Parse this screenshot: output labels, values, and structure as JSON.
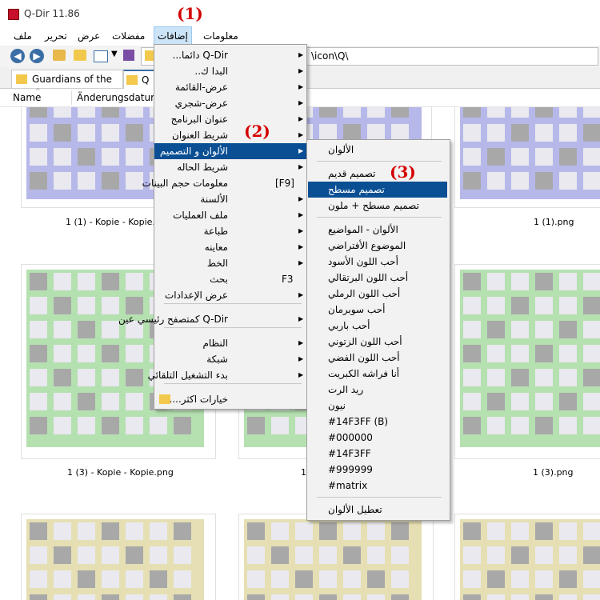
{
  "window": {
    "title": "Q-Dir 11.86"
  },
  "menubar": {
    "items": [
      {
        "label": "معلومات"
      },
      {
        "label": "إضافات"
      },
      {
        "label": "مفضلات"
      },
      {
        "label": "عرض"
      },
      {
        "label": "تحرير"
      },
      {
        "label": "ملف"
      }
    ]
  },
  "address": {
    "path": "\\icon\\Q\\"
  },
  "tabs": [
    {
      "label": "Guardians of the ..."
    },
    {
      "label": "Q"
    }
  ],
  "columns": {
    "name": "Name",
    "date": "Änderungsdatum"
  },
  "files": {
    "row1": [
      "1 (1) - Kopie - Kopie.png",
      "1 (1).png"
    ],
    "row2": [
      "1 (3) - Kopie - Kopie.png",
      "1",
      "1 (3).png"
    ]
  },
  "annotations": {
    "one": "(1)",
    "two": "(2)",
    "three": "(3)"
  },
  "extras_menu": {
    "items": [
      {
        "label": "Q-Dir دائما..."
      },
      {
        "label": "البدا ك.."
      },
      {
        "label": "عرض-القائمة"
      },
      {
        "label": "عرض-شجري"
      },
      {
        "label": "عنوان البرنامج"
      },
      {
        "label": "شريط العنوان"
      },
      {
        "label": "الألوان و التصميم"
      },
      {
        "label": "شريط الحاله"
      },
      {
        "label": "معلومات حجم البينات",
        "shortcut": "[F9]"
      },
      {
        "label": "الألسنة"
      },
      {
        "label": "ملف العمليات"
      },
      {
        "label": "طباعة"
      },
      {
        "label": "معاينه"
      },
      {
        "label": "الخط"
      },
      {
        "label": "بحث",
        "shortcut": "F3"
      },
      {
        "label": "عرض الإعدادات"
      },
      {
        "label": "Q-Dir كمتصفح رئيسي عين"
      },
      {
        "label": "النظام"
      },
      {
        "label": "شبكة"
      },
      {
        "label": "بدء التشغيل التلقائي"
      },
      {
        "label": "خيارات اكثر...."
      }
    ]
  },
  "colors_menu": {
    "items": [
      {
        "label": "الألوان"
      },
      {
        "label": "تصميم قديم"
      },
      {
        "label": "تصميم مسطح"
      },
      {
        "label": "تصميم مسطح + ملون"
      },
      {
        "label": "الألوان - المواضيع"
      },
      {
        "label": "الموضوع الأفتراضي"
      },
      {
        "label": "أحب اللون الأسود"
      },
      {
        "label": "أحب اللون البرتقالي"
      },
      {
        "label": "أحب اللون الرملي"
      },
      {
        "label": "أحب سوبرمان"
      },
      {
        "label": "أحب باربي"
      },
      {
        "label": "أحب اللون الزتوني"
      },
      {
        "label": "أحب اللون الفضي"
      },
      {
        "label": "أنا فراشه الكبريت"
      },
      {
        "label": "ريد الرت"
      },
      {
        "label": "نيون"
      },
      {
        "label": "#14F3FF (B)"
      },
      {
        "label": "#000000"
      },
      {
        "label": "#14F3FF"
      },
      {
        "label": "#999999"
      },
      {
        "label": "#matrix"
      },
      {
        "label": "تعطيل الألوان"
      }
    ]
  },
  "colors": {
    "highlight": "#0a4f94",
    "annotation": "#d40000",
    "thumb_purple": "#b7b8ea",
    "thumb_green": "#b5e0b0",
    "thumb_tan": "#e6dfb3"
  }
}
